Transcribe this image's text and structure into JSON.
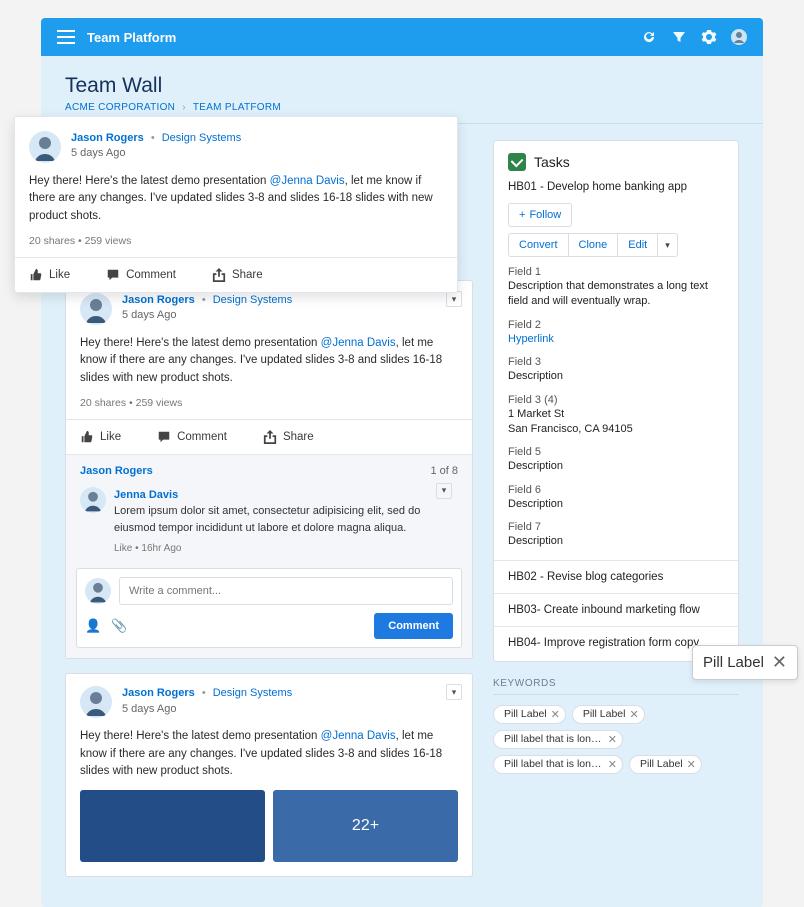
{
  "header": {
    "app_title": "Team Platform",
    "page_title": "Team Wall",
    "breadcrumb_1": "ACME CORPORATION",
    "breadcrumb_2": "TEAM PLATFORM"
  },
  "post": {
    "author": "Jason Rogers",
    "department": "Design Systems",
    "time": "5 days Ago",
    "body_a": "Hey there! Here's the latest demo presentation ",
    "mention": "@Jenna Davis",
    "body_b": ", let me know if there are any changes. I've updated slides 3-8 and slides 16-18 slides with new product shots.",
    "stats": "20 shares  •  259 views",
    "like": "Like",
    "comment": "Comment",
    "share": "Share"
  },
  "comments": {
    "header_author": "Jason Rogers",
    "page_count": "1 of 8",
    "c1_author": "Jenna Davis",
    "c1_body": "Lorem ipsum dolor sit amet, consectetur adipisicing elit, sed do eiusmod tempor incididunt ut labore et dolore magna aliqua.",
    "c1_meta": "Like  •  16hr Ago",
    "input_placeholder": "Write a comment...",
    "submit": "Comment"
  },
  "tiles": {
    "count": "22+"
  },
  "tasks": {
    "title": "Tasks",
    "main_task": "HB01 - Develop home banking app",
    "follow": "Follow",
    "convert": "Convert",
    "clone": "Clone",
    "edit": "Edit",
    "f1_label": "Field 1",
    "f1_desc": "Description that demonstrates a long text field and will eventually wrap.",
    "f2_label": "Field 2",
    "f2_desc": "Hyperlink",
    "f3_label": "Field 3",
    "f3_desc": "Description",
    "f4_label": "Field 3 (4)",
    "f4_desc1": "1 Market St",
    "f4_desc2": "San Francisco, CA 94105",
    "f5_label": "Field 5",
    "f5_desc": "Description",
    "f6_label": "Field 6",
    "f6_desc": "Description",
    "f7_label": "Field 7",
    "f7_desc": "Description",
    "t2": "HB02 - Revise blog categories",
    "t3": "HB03- Create inbound marketing flow",
    "t4": "HB04- Improve registration form copy"
  },
  "keywords": {
    "title": "KEYWORDS",
    "p1": "Pill Label",
    "p2": "Pill Label",
    "p3": "Pill label that is longer than the rest",
    "p4": "Pill label that is longer than the rest",
    "p5": "Pill Label"
  },
  "big_pill": "Pill Label"
}
